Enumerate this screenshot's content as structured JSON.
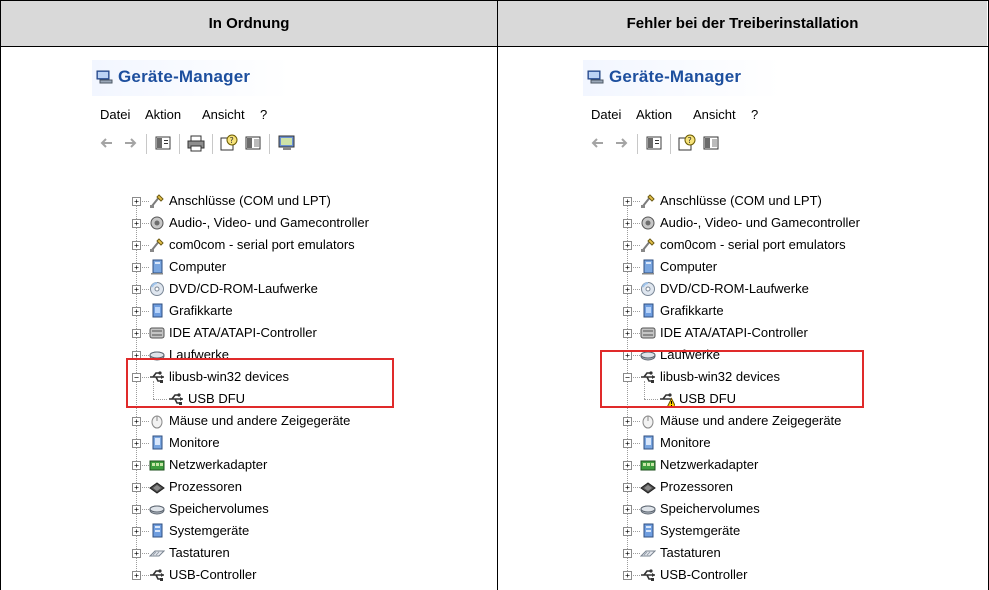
{
  "columns": [
    {
      "header": "In Ordnung",
      "window": {
        "title": "Geräte-Manager",
        "menu": [
          "Datei",
          "Aktion",
          "Ansicht",
          "?"
        ],
        "toolbar": [
          "back-icon",
          "forward-icon",
          "properties-icon",
          "print-icon",
          "help-icon",
          "view-icon",
          "scan-hardware-icon"
        ],
        "tree": [
          {
            "label": "Anschlüsse (COM und LPT)",
            "icon": "port-icon",
            "expander": "+"
          },
          {
            "label": "Audio-, Video- und Gamecontroller",
            "icon": "audio-icon",
            "expander": "+"
          },
          {
            "label": "com0com - serial port emulators",
            "icon": "port-icon",
            "expander": "+"
          },
          {
            "label": "Computer",
            "icon": "computer-icon",
            "expander": "+"
          },
          {
            "label": "DVD/CD-ROM-Laufwerke",
            "icon": "cdrom-icon",
            "expander": "+"
          },
          {
            "label": "Grafikkarte",
            "icon": "display-icon",
            "expander": "+"
          },
          {
            "label": "IDE ATA/ATAPI-Controller",
            "icon": "ide-icon",
            "expander": "+"
          },
          {
            "label": "Laufwerke",
            "icon": "disk-icon",
            "expander": "+"
          },
          {
            "label": "libusb-win32 devices",
            "icon": "usb-icon",
            "expander": "−"
          },
          {
            "label": "USB DFU",
            "icon": "usb-icon",
            "child": true
          },
          {
            "label": "Mäuse und andere Zeigegeräte",
            "icon": "mouse-icon",
            "expander": "+"
          },
          {
            "label": "Monitore",
            "icon": "monitor-icon",
            "expander": "+"
          },
          {
            "label": "Netzwerkadapter",
            "icon": "network-icon",
            "expander": "+"
          },
          {
            "label": "Prozessoren",
            "icon": "cpu-icon",
            "expander": "+"
          },
          {
            "label": "Speichervolumes",
            "icon": "disk-icon",
            "expander": "+"
          },
          {
            "label": "Systemgeräte",
            "icon": "system-icon",
            "expander": "+"
          },
          {
            "label": "Tastaturen",
            "icon": "keyboard-icon",
            "expander": "+"
          },
          {
            "label": "USB-Controller",
            "icon": "usb-icon",
            "expander": "+"
          }
        ]
      }
    },
    {
      "header": "Fehler bei der Treiberinstallation",
      "window": {
        "title": "Geräte-Manager",
        "menu": [
          "Datei",
          "Aktion",
          "Ansicht",
          "?"
        ],
        "toolbar": [
          "back-icon",
          "forward-icon",
          "properties-icon",
          "help-icon",
          "view-icon"
        ],
        "tree": [
          {
            "label": "Anschlüsse (COM und LPT)",
            "icon": "port-icon",
            "expander": "+"
          },
          {
            "label": "Audio-, Video- und Gamecontroller",
            "icon": "audio-icon",
            "expander": "+"
          },
          {
            "label": "com0com - serial port emulators",
            "icon": "port-icon",
            "expander": "+"
          },
          {
            "label": "Computer",
            "icon": "computer-icon",
            "expander": "+"
          },
          {
            "label": "DVD/CD-ROM-Laufwerke",
            "icon": "cdrom-icon",
            "expander": "+"
          },
          {
            "label": "Grafikkarte",
            "icon": "display-icon",
            "expander": "+"
          },
          {
            "label": "IDE ATA/ATAPI-Controller",
            "icon": "ide-icon",
            "expander": "+"
          },
          {
            "label": "Laufwerke",
            "icon": "disk-icon",
            "expander": "+"
          },
          {
            "label": "libusb-win32 devices",
            "icon": "usb-icon",
            "expander": "−"
          },
          {
            "label": "USB DFU",
            "icon": "usb-warning-icon",
            "child": true
          },
          {
            "label": "Mäuse und andere Zeigegeräte",
            "icon": "mouse-icon",
            "expander": "+"
          },
          {
            "label": "Monitore",
            "icon": "monitor-icon",
            "expander": "+"
          },
          {
            "label": "Netzwerkadapter",
            "icon": "network-icon",
            "expander": "+"
          },
          {
            "label": "Prozessoren",
            "icon": "cpu-icon",
            "expander": "+"
          },
          {
            "label": "Speichervolumes",
            "icon": "disk-icon",
            "expander": "+"
          },
          {
            "label": "Systemgeräte",
            "icon": "system-icon",
            "expander": "+"
          },
          {
            "label": "Tastaturen",
            "icon": "keyboard-icon",
            "expander": "+"
          },
          {
            "label": "USB-Controller",
            "icon": "usb-icon",
            "expander": "+"
          }
        ]
      }
    }
  ],
  "colors": {
    "header_bg": "#d9d9d9",
    "highlight": "#e02a2a",
    "title": "#1d4f9e",
    "warning": "#ffd200"
  }
}
